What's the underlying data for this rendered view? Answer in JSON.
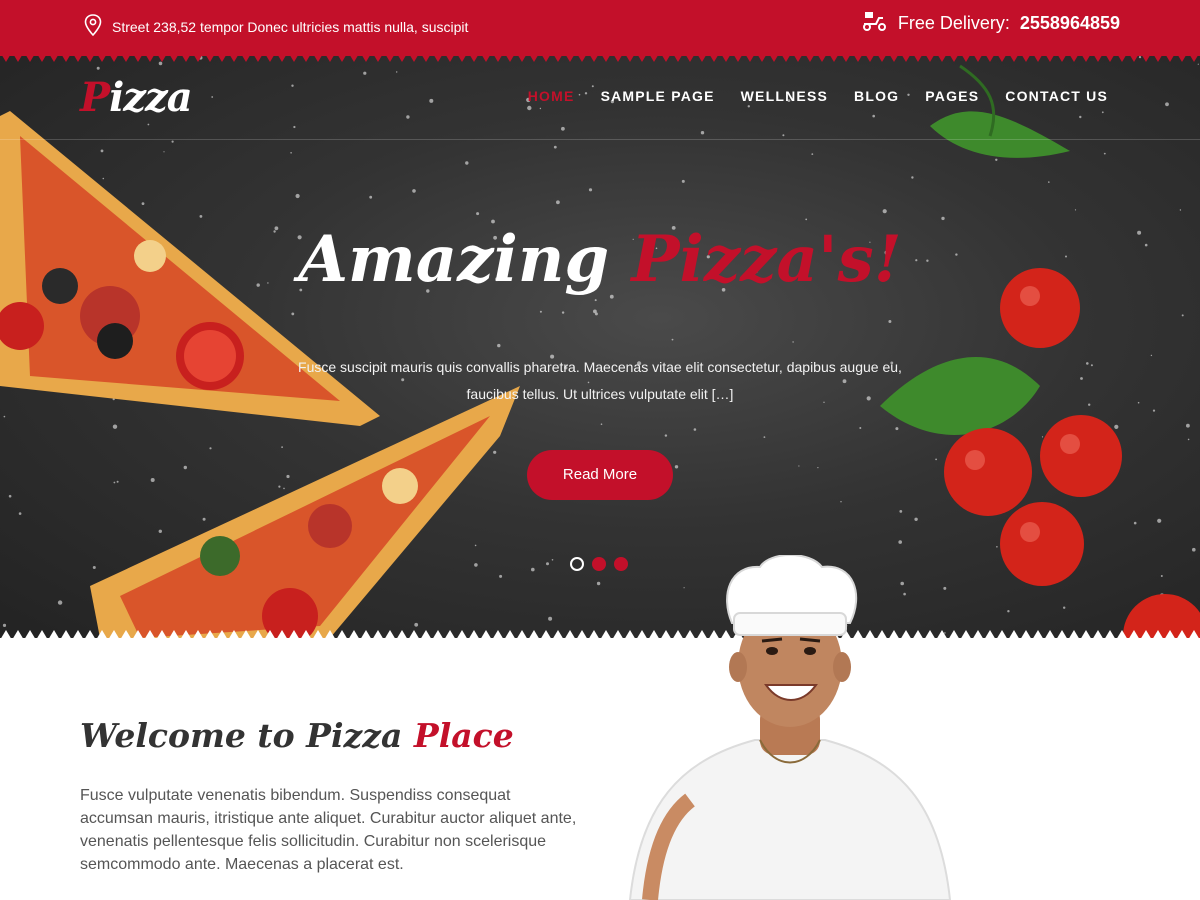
{
  "topbar": {
    "address": "Street 238,52 tempor Donec ultricies mattis nulla, suscipit",
    "delivery_label": "Free Delivery:",
    "delivery_phone": "2558964859",
    "icons": [
      "location-pin-icon",
      "delivery-scooter-icon"
    ]
  },
  "logo": {
    "first_letter": "P",
    "rest": "izza"
  },
  "nav": {
    "items": [
      {
        "label": "HOME",
        "active": true
      },
      {
        "label": "SAMPLE PAGE",
        "active": false
      },
      {
        "label": "WELLNESS",
        "active": false
      },
      {
        "label": "BLOG",
        "active": false
      },
      {
        "label": "PAGES",
        "active": false
      },
      {
        "label": "CONTACT US",
        "active": false
      }
    ]
  },
  "hero": {
    "title_white": "Amazing",
    "title_red": "Pizza's!",
    "text": "Fusce suscipit mauris quis convallis pharetra. Maecenas vitae elit consectetur, dapibus augue eu, faucibus tellus. Ut ultrices vulputate elit […]",
    "button": "Read More",
    "slides": 3,
    "active_slide": 1
  },
  "welcome": {
    "title_dark": "Welcome to Pizza",
    "title_red": "Place",
    "text": "Fusce vulputate venenatis bibendum. Suspendiss consequat accumsan mauris, itristique ante aliquet. Curabitur auctor aliquet ante, venenatis pellentesque felis sollicitudin. Curabitur non scelerisque semcommodo ante. Maecenas a placerat est."
  },
  "colors": {
    "brand_red": "#c3102a",
    "dark": "#2c2c2c"
  }
}
